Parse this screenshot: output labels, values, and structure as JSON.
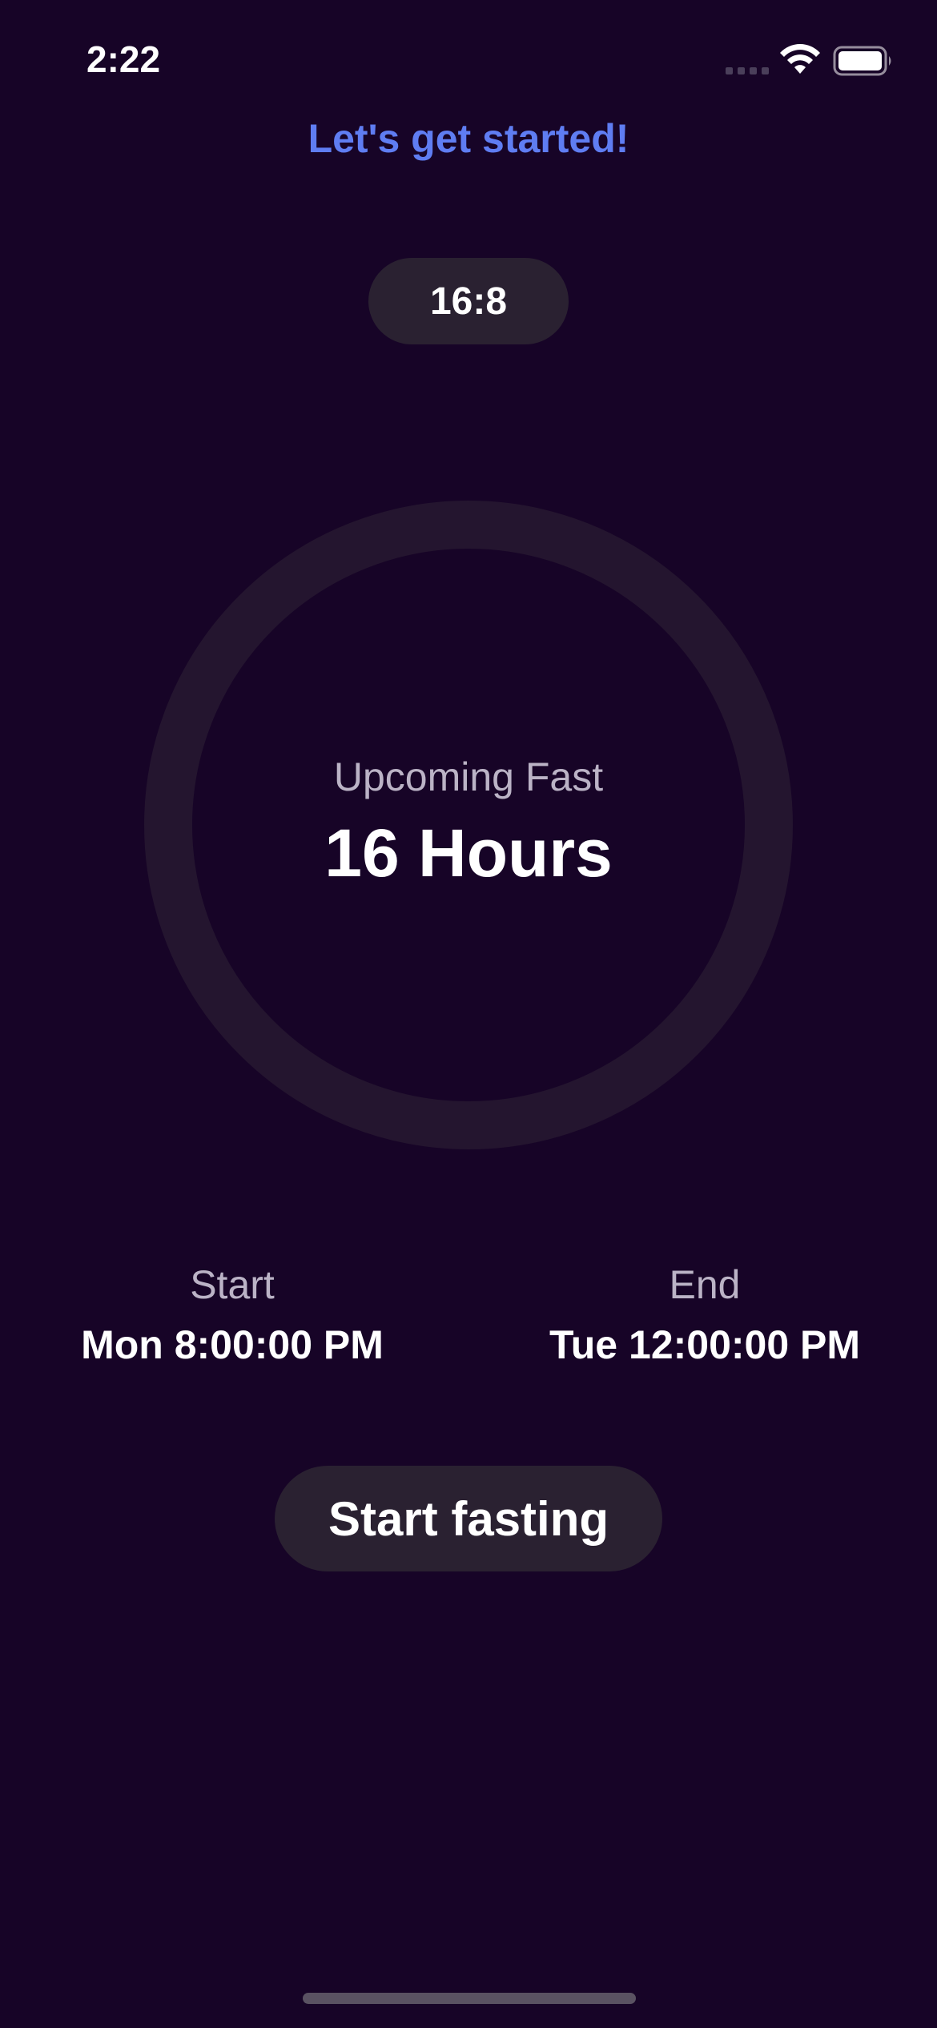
{
  "status_bar": {
    "time": "2:22",
    "signal_icon": "signal-icon",
    "wifi_icon": "wifi-icon",
    "battery_icon": "battery-icon"
  },
  "header": {
    "title": "Let's get started!"
  },
  "plan": {
    "label": "16:8"
  },
  "ring": {
    "label": "Upcoming Fast",
    "value": "16 Hours",
    "progress": 0,
    "track_color": "#24152f",
    "background_color": "#170427"
  },
  "schedule": {
    "start_label": "Start",
    "start_value": "Mon 8:00:00 PM",
    "end_label": "End",
    "end_value": "Tue 12:00:00 PM"
  },
  "actions": {
    "start_button": "Start fasting"
  },
  "colors": {
    "accent": "#5f7df2",
    "pill_background": "#2a2131",
    "secondary_text": "#bbb3c6"
  }
}
